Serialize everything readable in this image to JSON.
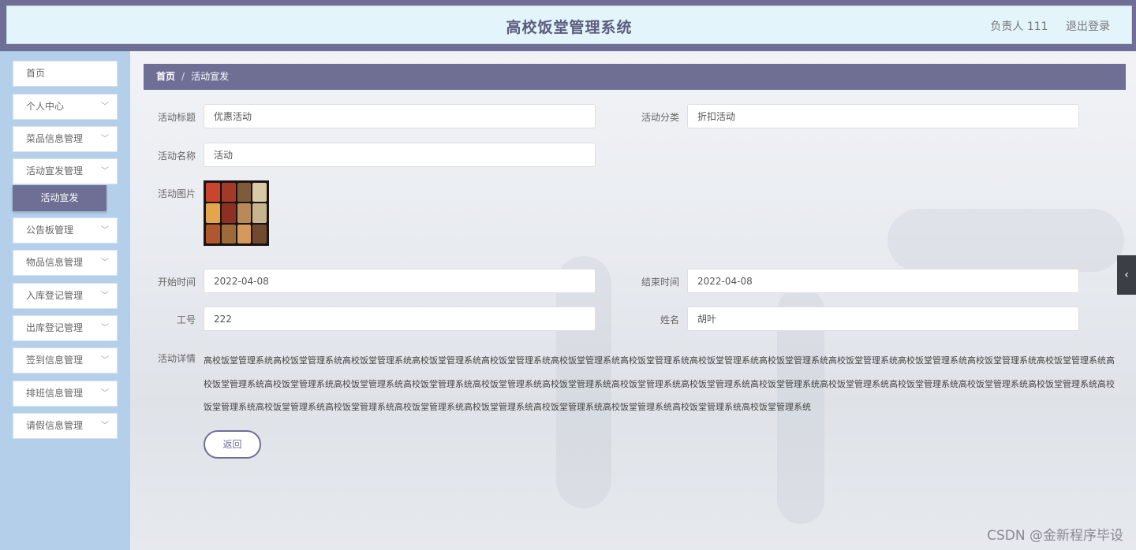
{
  "header": {
    "title": "高校饭堂管理系统",
    "user_label": "负责人 111",
    "logout_label": "退出登录"
  },
  "sidebar": {
    "items": [
      {
        "label": "首页",
        "has_chevron": false
      },
      {
        "label": "个人中心",
        "has_chevron": true
      },
      {
        "label": "菜品信息管理",
        "has_chevron": true
      },
      {
        "label": "活动宣发管理",
        "has_chevron": true,
        "expanded": true,
        "children": [
          {
            "label": "活动宣发",
            "active": true
          }
        ]
      },
      {
        "label": "公告板管理",
        "has_chevron": true
      },
      {
        "label": "物品信息管理",
        "has_chevron": true
      },
      {
        "label": "入库登记管理",
        "has_chevron": true
      },
      {
        "label": "出库登记管理",
        "has_chevron": true
      },
      {
        "label": "签到信息管理",
        "has_chevron": true
      },
      {
        "label": "排班信息管理",
        "has_chevron": true
      },
      {
        "label": "请假信息管理",
        "has_chevron": true
      }
    ],
    "chevron_glyph": "﹀"
  },
  "breadcrumb": {
    "home": "首页",
    "separator": "/",
    "current": "活动宣发"
  },
  "form": {
    "title_label": "活动标题",
    "title_value": "优惠活动",
    "category_label": "活动分类",
    "category_value": "折扣活动",
    "name_label": "活动名称",
    "name_value": "活动",
    "image_label": "活动图片",
    "start_label": "开始时间",
    "start_value": "2022-04-08",
    "end_label": "结束时间",
    "end_value": "2022-04-08",
    "job_no_label": "工号",
    "job_no_value": "222",
    "person_name_label": "姓名",
    "person_name_value": "胡叶",
    "details_label": "活动详情",
    "details_value": "高校饭堂管理系统高校饭堂管理系统高校饭堂管理系统高校饭堂管理系统高校饭堂管理系统高校饭堂管理系统高校饭堂管理系统高校饭堂管理系统高校饭堂管理系统高校饭堂管理系统高校饭堂管理系统高校饭堂管理系统高校饭堂管理系统高校饭堂管理系统高校饭堂管理系统高校饭堂管理系统高校饭堂管理系统高校饭堂管理系统高校饭堂管理系统高校饭堂管理系统高校饭堂管理系统高校饭堂管理系统高校饭堂管理系统高校饭堂管理系统高校饭堂管理系统高校饭堂管理系统高校饭堂管理系统高校饭堂管理系统高校饭堂管理系统高校饭堂管理系统高校饭堂管理系统高校饭堂管理系统高校饭堂管理系统高校饭堂管理系统高校饭堂管理系统",
    "back_label": "返回"
  },
  "side_toggle_glyph": "‹",
  "watermark": "CSDN @金新程序毕设",
  "colors": {
    "primary": "#6f6f95",
    "sidebar_bg": "#b3cfea",
    "header_bg": "#e3f4fb"
  }
}
